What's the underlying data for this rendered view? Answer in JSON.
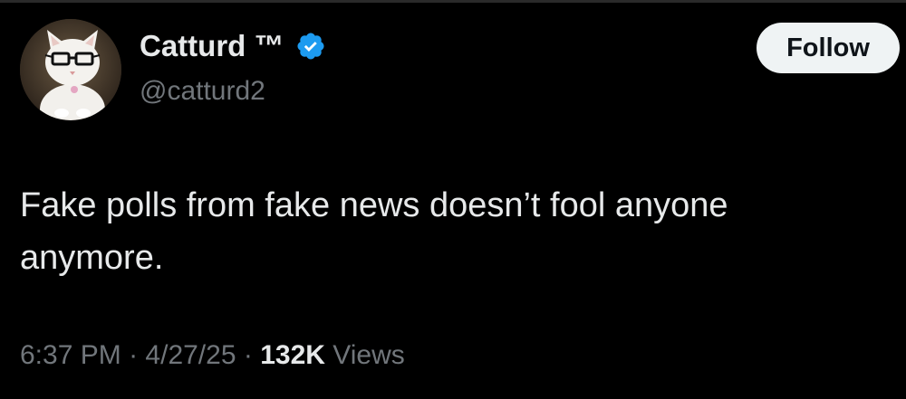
{
  "author": {
    "display_name": "Catturd ™",
    "handle": "@catturd2",
    "verified": true,
    "avatar": "cat-with-glasses-avatar"
  },
  "follow_button": {
    "label": "Follow"
  },
  "tweet": {
    "text": "Fake polls from fake news doesn’t fool anyone anymore."
  },
  "meta": {
    "time": "6:37 PM",
    "separator": "·",
    "date": "4/27/25",
    "views_count": "132K",
    "views_label": "Views"
  },
  "colors": {
    "background": "#000000",
    "primary_text": "#e7e9ea",
    "secondary_text": "#71767b",
    "verified_blue": "#1d9bf0",
    "follow_button_bg": "#eff3f4",
    "follow_button_text": "#0f1419"
  },
  "icons": {
    "verified": "verified-badge-icon"
  }
}
